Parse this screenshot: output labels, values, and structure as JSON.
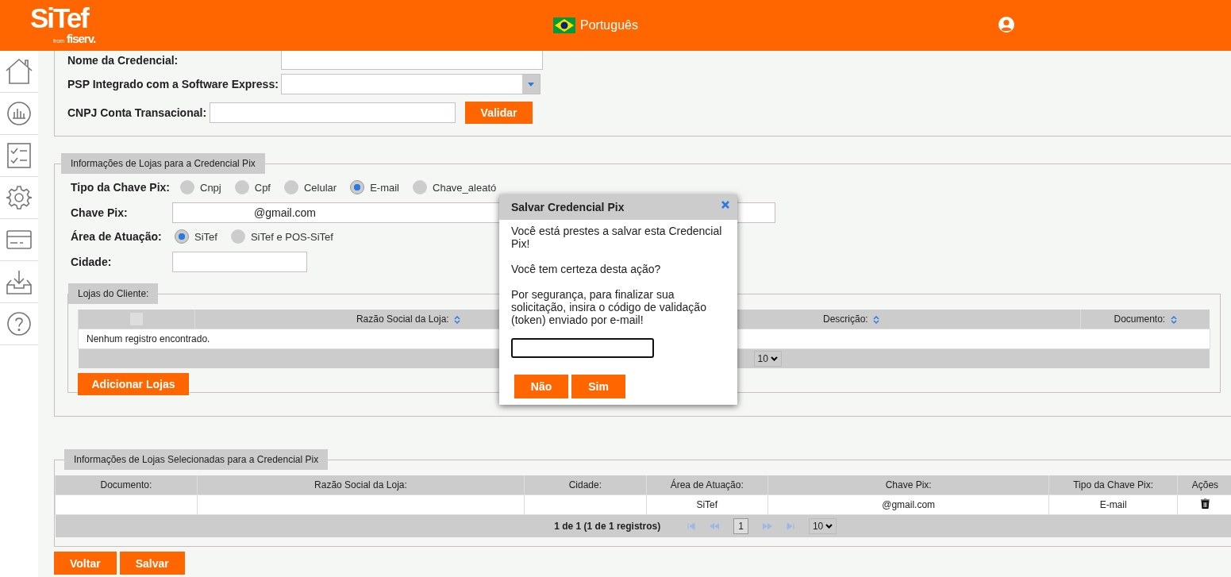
{
  "header": {
    "logo": "SiTef",
    "logo_from": "from",
    "logo_brand": "fiserv.",
    "language": "Português"
  },
  "credential": {
    "name_label": "Nome da Credencial:",
    "psp_label": "PSP Integrado com a Software Express:",
    "cnpj_label": "CNPJ Conta Transacional:",
    "validate_button": "Validar"
  },
  "store_info": {
    "legend": "Informações de Lojas para a Credencial Pix",
    "key_type": {
      "label": "Tipo da Chave Pix:",
      "options": [
        {
          "label": "Cnpj",
          "selected": false
        },
        {
          "label": "Cpf",
          "selected": false
        },
        {
          "label": "Celular",
          "selected": false
        },
        {
          "label": "E-mail",
          "selected": true
        },
        {
          "label": "Chave_aleató",
          "selected": false
        }
      ]
    },
    "key": {
      "label": "Chave Pix:",
      "value": "@gmail.com"
    },
    "area": {
      "label": "Área de Atuação:",
      "options": [
        {
          "label": "SiTef",
          "selected": true
        },
        {
          "label": "SiTef e POS-SiTef",
          "selected": false
        }
      ]
    },
    "city": {
      "label": "Cidade:"
    }
  },
  "client_stores": {
    "legend": "Lojas do Cliente:",
    "select_all": {
      "checked": false
    },
    "columns": [
      "Razão Social da Loja:",
      "Descrição:",
      "Documento:"
    ],
    "empty_message": "Nenhum registro encontrado.",
    "page_size": "10",
    "add_button": "Adicionar Lojas"
  },
  "selected_stores": {
    "legend": "Informações de Lojas Selecionadas para a Credencial Pix",
    "columns": [
      "Documento:",
      "Razão Social da Loja:",
      "Cidade:",
      "Área de Atuação:",
      "Chave Pix:",
      "Tipo da Chave Pix:",
      "Ações"
    ],
    "rows": [
      {
        "area": "SiTef",
        "key": "@gmail.com",
        "key_type": "E-mail"
      }
    ],
    "pager": {
      "summary": "1 de 1 (1 de 1 registros)",
      "page": "1",
      "page_size": "10"
    }
  },
  "actions": [
    "Voltar",
    "Salvar"
  ],
  "dialog": {
    "title": "Salvar Credencial Pix",
    "paragraphs": [
      "Você está prestes a salvar esta Credencial Pix!",
      "Você tem certeza desta ação?",
      "Por segurança, para finalizar sua solicitação, insira o código de validação (token) enviado por e-mail!"
    ],
    "buttons": [
      "Não",
      "Sim"
    ]
  }
}
